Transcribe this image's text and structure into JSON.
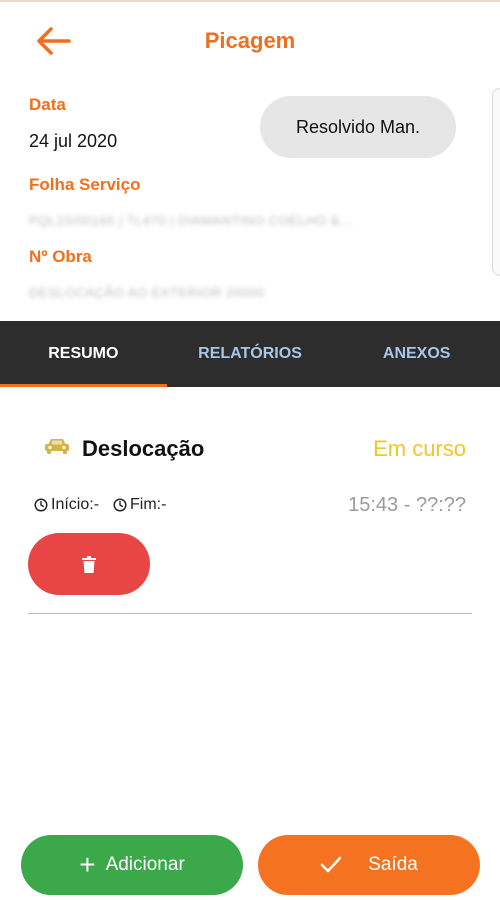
{
  "header": {
    "title": "Picagem",
    "back_icon": "arrow-left-icon"
  },
  "info": {
    "data_label": "Data",
    "data_value": "24 jul 2020",
    "folha_label": "Folha Serviço",
    "folha_value": "PQL15/00165 | TL470 | DIAMANTINO COELHO &...",
    "obra_label": "Nº Obra",
    "obra_value": "DESLOCAÇÃO AO EXTERIOR 20000",
    "status_pill": "Resolvido Man."
  },
  "tabs": [
    {
      "label": "RESUMO",
      "active": true
    },
    {
      "label": "RELATÓRIOS",
      "active": false
    },
    {
      "label": "ANEXOS",
      "active": false
    }
  ],
  "entry": {
    "icon": "car-icon",
    "title": "Deslocação",
    "status": "Em curso",
    "inicio": "Início:-",
    "fim": "Fim:-",
    "time_range": "15:43 - ??:??",
    "delete_icon": "trash-icon"
  },
  "actions": {
    "add_label": "Adicionar",
    "exit_label": "Saída"
  },
  "colors": {
    "accent": "#f06f1e",
    "tab_bar": "#2d2d2d",
    "status_in_progress": "#f2c52b",
    "delete": "#e84545",
    "add": "#3ba84a",
    "exit": "#f57320"
  }
}
